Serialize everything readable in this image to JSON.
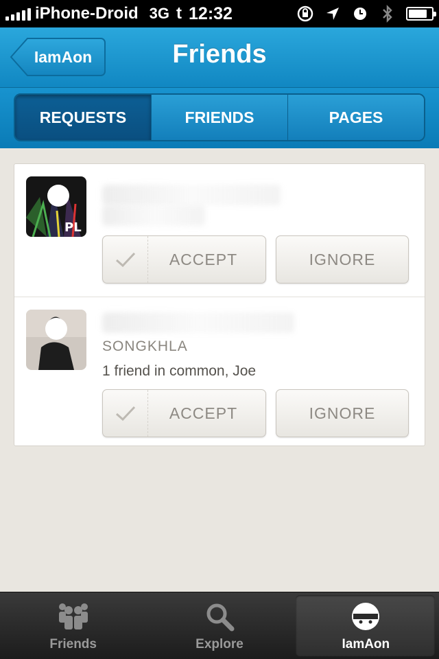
{
  "status_bar": {
    "carrier": "iPhone-Droid",
    "network": "3G",
    "twitter_glyph": "t",
    "time": "12:32"
  },
  "nav": {
    "back_label": "IamAon",
    "title": "Friends"
  },
  "segments": {
    "requests": "REQUESTS",
    "friends": "FRIENDS",
    "pages": "PAGES",
    "active": "REQUESTS"
  },
  "requests": [
    {
      "location": "",
      "mutual": "",
      "accept_label": "ACCEPT",
      "ignore_label": "IGNORE"
    },
    {
      "location": "SONGKHLA",
      "mutual": "1 friend in common, Joe",
      "accept_label": "ACCEPT",
      "ignore_label": "IGNORE"
    }
  ],
  "tabs": {
    "friends": "Friends",
    "explore": "Explore",
    "profile": "IamAon",
    "active": "IamAon"
  },
  "colors": {
    "accent": "#1187c2",
    "background": "#e9e6e0",
    "tab_bar": "#1c1c1c"
  }
}
